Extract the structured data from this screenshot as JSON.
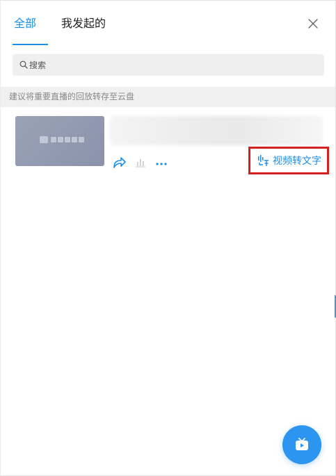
{
  "tabs": [
    {
      "label": "全部",
      "active": true
    },
    {
      "label": "我发起的",
      "active": false
    }
  ],
  "close_icon": "close-icon",
  "search": {
    "placeholder": "搜索",
    "value": "",
    "icon": "search-icon"
  },
  "notice": "建议将重要直播的回放转存至云盘",
  "live_item": {
    "thumbnail_icon": "tv-logo-icon",
    "actions": [
      {
        "name": "share-icon"
      },
      {
        "name": "stats-icon"
      },
      {
        "name": "more-icon"
      }
    ],
    "convert_label": "视频转文字",
    "convert_icon": "voice-to-text-icon"
  },
  "fab_icon": "live-tv-icon",
  "colors": {
    "accent": "#1b8ee8",
    "highlight_border": "#d61f1f",
    "fab": "#2c95f0"
  }
}
